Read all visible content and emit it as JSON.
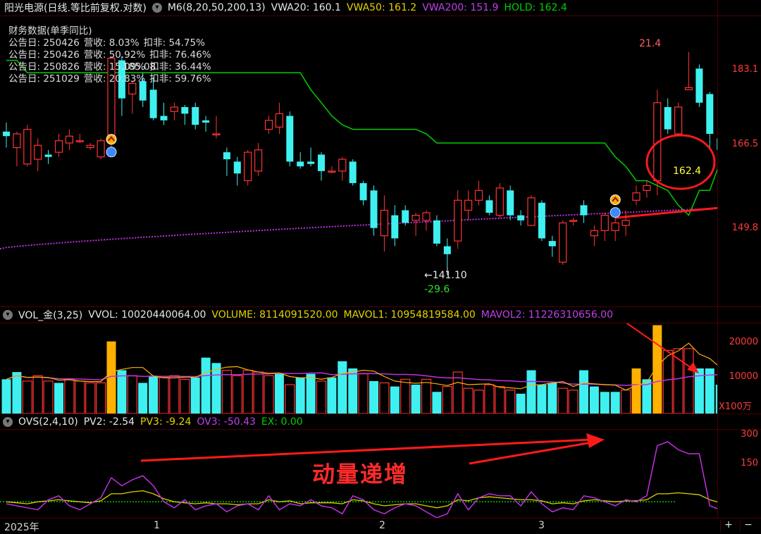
{
  "main_header": {
    "title": "阳光电源(日线.等比前复权.对数)",
    "indicator": "M6(8,20,50,200,13)",
    "vwa20": "VWA20: 160.1",
    "vwa50": "VWA50: 161.2",
    "vwa200": "VWA200: 151.9",
    "hold": "HOLD: 162.4"
  },
  "financial": {
    "title": "财务数据(单季同比)",
    "rows": [
      {
        "date": "公告日: 250426",
        "rev": "营收:  8.03%",
        "net": "扣非:  54.75%"
      },
      {
        "date": "公告日: 250426",
        "rev": "营收:  50.92%",
        "net": "扣非:  76.46%"
      },
      {
        "date": "公告日: 250826",
        "rev": "营收:  15.09%",
        "net": "扣非:  36.44%"
      },
      {
        "date": "公告日: 251029",
        "rev": "营收:  20.83%",
        "net": "扣非:  59.76%"
      }
    ],
    "overlap_text": "185.08"
  },
  "price_annotations": {
    "high_change": "21.4",
    "low_price": "←141.10",
    "low_change": "-29.6",
    "hold_value": "162.4"
  },
  "vol_header": {
    "name": "VOL_金(3,25)",
    "vvol": "VVOL: 10020440064.00",
    "volume": "VOLUME: 8114091520.00",
    "mavol1": "MAVOL1: 10954819584.00",
    "mavol2": "MAVOL2: 11226310656.00"
  },
  "vol_unit": "X100万",
  "ovs_header": {
    "name": "OVS(2,4,10)",
    "pv2": "PV2: -2.54",
    "pv3": "PV3: -9.24",
    "ov3": "OV3: -50.43",
    "ex": "EX: 0.00"
  },
  "big_note": "动量递增",
  "xaxis": {
    "year": "2025年",
    "m1": "1",
    "m2": "2",
    "m3": "3"
  },
  "zoom": {
    "plus": "+",
    "minus": "−"
  },
  "colors": {
    "up": "#ff3333",
    "down": "#3ff0f0",
    "vwa20": "#00cc00",
    "vwa200": "#c030e0",
    "hold": "#ff1a1a",
    "gold": "#ffb000",
    "ovs_pv2": "#c030e0",
    "ovs_pv3": "#e0d000",
    "ovs_ex": "#00cc00"
  },
  "chart_data": [
    {
      "type": "candlestick",
      "name": "price",
      "ylim": [
        134,
        196
      ],
      "scale": "log",
      "y_ticks": [
        183.1,
        166.5,
        149.8
      ],
      "candles": [
        {
          "o": 168.5,
          "h": 170.5,
          "l": 165,
          "c": 167.5
        },
        {
          "o": 165,
          "h": 168.5,
          "l": 161,
          "c": 168
        },
        {
          "o": 161.5,
          "h": 170,
          "l": 161,
          "c": 169
        },
        {
          "o": 162.5,
          "h": 167,
          "l": 160,
          "c": 165.5
        },
        {
          "o": 163.5,
          "h": 164.5,
          "l": 161.5,
          "c": 163
        },
        {
          "o": 164,
          "h": 168,
          "l": 163,
          "c": 166.5
        },
        {
          "o": 166,
          "h": 169,
          "l": 164.5,
          "c": 167.5
        },
        {
          "o": 166.5,
          "h": 168,
          "l": 166,
          "c": 166.5
        },
        {
          "o": 165,
          "h": 166,
          "l": 164.5,
          "c": 165.5
        },
        {
          "o": 163,
          "h": 167,
          "l": 162.5,
          "c": 166.5
        },
        {
          "o": 167,
          "h": 186,
          "l": 165,
          "c": 185.5
        },
        {
          "o": 185,
          "h": 186,
          "l": 172,
          "c": 176
        },
        {
          "o": 177,
          "h": 180,
          "l": 172.5,
          "c": 179.5
        },
        {
          "o": 180,
          "h": 182,
          "l": 174,
          "c": 175.5
        },
        {
          "o": 178,
          "h": 181,
          "l": 171,
          "c": 171.5
        },
        {
          "o": 172,
          "h": 175,
          "l": 170,
          "c": 171
        },
        {
          "o": 173,
          "h": 175,
          "l": 171,
          "c": 174
        },
        {
          "o": 174,
          "h": 174.5,
          "l": 170,
          "c": 172.5
        },
        {
          "o": 174,
          "h": 175,
          "l": 169,
          "c": 170
        },
        {
          "o": 171,
          "h": 172,
          "l": 168.5,
          "c": 170.5
        },
        {
          "o": 168,
          "h": 172,
          "l": 167,
          "c": 168
        },
        {
          "o": 164,
          "h": 165,
          "l": 159,
          "c": 162.5
        },
        {
          "o": 162,
          "h": 163,
          "l": 157,
          "c": 159.5
        },
        {
          "o": 158,
          "h": 164.5,
          "l": 157,
          "c": 164
        },
        {
          "o": 160,
          "h": 166,
          "l": 159,
          "c": 164.5
        },
        {
          "o": 169,
          "h": 172,
          "l": 168,
          "c": 171
        },
        {
          "o": 169.5,
          "h": 175,
          "l": 168,
          "c": 172.5
        },
        {
          "o": 172,
          "h": 173,
          "l": 161,
          "c": 162
        },
        {
          "o": 162,
          "h": 164,
          "l": 160.5,
          "c": 161
        },
        {
          "o": 162,
          "h": 165,
          "l": 161,
          "c": 161.5
        },
        {
          "o": 163.5,
          "h": 164,
          "l": 158,
          "c": 160
        },
        {
          "o": 160,
          "h": 161,
          "l": 159.5,
          "c": 160
        },
        {
          "o": 160,
          "h": 163,
          "l": 158,
          "c": 162.5
        },
        {
          "o": 162,
          "h": 162.5,
          "l": 157,
          "c": 157.5
        },
        {
          "o": 157.5,
          "h": 158,
          "l": 153,
          "c": 154
        },
        {
          "o": 156,
          "h": 157,
          "l": 147,
          "c": 148.5
        },
        {
          "o": 147,
          "h": 155,
          "l": 144,
          "c": 152
        },
        {
          "o": 151,
          "h": 153,
          "l": 145,
          "c": 146.5
        },
        {
          "o": 152,
          "h": 153,
          "l": 149,
          "c": 149.5
        },
        {
          "o": 150,
          "h": 151.5,
          "l": 147,
          "c": 151
        },
        {
          "o": 150,
          "h": 152,
          "l": 148,
          "c": 151.5
        },
        {
          "o": 150,
          "h": 151,
          "l": 145,
          "c": 145.5
        },
        {
          "o": 145,
          "h": 146.5,
          "l": 141.1,
          "c": 143.5
        },
        {
          "o": 146,
          "h": 156,
          "l": 144.5,
          "c": 154
        },
        {
          "o": 152,
          "h": 156,
          "l": 150,
          "c": 154
        },
        {
          "o": 154,
          "h": 158,
          "l": 153,
          "c": 156
        },
        {
          "o": 154,
          "h": 155,
          "l": 151,
          "c": 151.5
        },
        {
          "o": 151,
          "h": 157.5,
          "l": 150.5,
          "c": 156.5
        },
        {
          "o": 156,
          "h": 157,
          "l": 150,
          "c": 151
        },
        {
          "o": 151,
          "h": 152,
          "l": 149,
          "c": 150
        },
        {
          "o": 149,
          "h": 155,
          "l": 149,
          "c": 154.5
        },
        {
          "o": 153.5,
          "h": 154,
          "l": 146,
          "c": 146.5
        },
        {
          "o": 146,
          "h": 147,
          "l": 143,
          "c": 145
        },
        {
          "o": 142,
          "h": 150,
          "l": 141.5,
          "c": 149.5
        },
        {
          "o": 150,
          "h": 150.5,
          "l": 149,
          "c": 150
        },
        {
          "o": 153,
          "h": 154,
          "l": 149.5,
          "c": 151
        },
        {
          "o": 147,
          "h": 149,
          "l": 145,
          "c": 148
        },
        {
          "o": 148,
          "h": 151.5,
          "l": 146,
          "c": 151
        },
        {
          "o": 148,
          "h": 151,
          "l": 146,
          "c": 149.5
        },
        {
          "o": 149,
          "h": 152,
          "l": 147,
          "c": 150
        },
        {
          "o": 154,
          "h": 157,
          "l": 153,
          "c": 155.5
        },
        {
          "o": 156,
          "h": 158,
          "l": 154.5,
          "c": 157
        },
        {
          "o": 158,
          "h": 178,
          "l": 155,
          "c": 175
        },
        {
          "o": 174,
          "h": 176,
          "l": 168,
          "c": 169
        },
        {
          "o": 168,
          "h": 175,
          "l": 168,
          "c": 174
        },
        {
          "o": 178,
          "h": 187,
          "l": 178,
          "c": 178.5
        },
        {
          "o": 183,
          "h": 184,
          "l": 174,
          "c": 175
        },
        {
          "o": 177,
          "h": 177.5,
          "l": 165,
          "c": 168
        },
        {
          "o": 167,
          "h": 168,
          "l": 164,
          "c": 164.5
        }
      ],
      "vwa20_line": [
        185,
        185,
        182,
        182,
        182,
        182,
        182,
        182,
        182,
        182,
        182,
        182,
        182,
        182,
        182,
        182,
        182,
        182,
        182,
        182,
        182,
        182,
        182,
        182,
        182,
        182,
        182,
        182,
        182,
        178,
        175,
        172,
        170,
        169,
        169,
        169,
        169,
        169,
        169,
        169,
        168,
        166,
        166,
        166,
        166,
        166,
        166,
        166,
        166,
        166,
        166,
        166,
        166,
        166,
        166,
        166,
        166,
        166,
        163,
        161,
        158,
        158,
        157,
        156,
        153,
        151,
        156,
        156,
        162,
        163
      ],
      "vwa200_line_range": [
        144.5,
        152.5
      ],
      "hold_line_range": [
        150.5,
        152.5
      ]
    },
    {
      "type": "bar",
      "name": "volume",
      "ylim": [
        0,
        25000
      ],
      "y_ticks": [
        20000,
        10000
      ],
      "bars": [
        {
          "v": 9500,
          "up": false
        },
        {
          "v": 11500,
          "up": false
        },
        {
          "v": 9000,
          "up": true
        },
        {
          "v": 10500,
          "up": true
        },
        {
          "v": 9000,
          "up": true
        },
        {
          "v": 8500,
          "up": false
        },
        {
          "v": 9500,
          "up": true
        },
        {
          "v": 9000,
          "up": true
        },
        {
          "v": 8500,
          "up": true
        },
        {
          "v": 8500,
          "up": true
        },
        {
          "v": 20000,
          "gold": true
        },
        {
          "v": 12000,
          "up": false
        },
        {
          "v": 10500,
          "up": true
        },
        {
          "v": 8500,
          "up": false
        },
        {
          "v": 10500,
          "up": false
        },
        {
          "v": 10000,
          "up": true
        },
        {
          "v": 10500,
          "up": true
        },
        {
          "v": 9500,
          "up": true
        },
        {
          "v": 10000,
          "up": false
        },
        {
          "v": 15500,
          "up": false
        },
        {
          "v": 14000,
          "up": false
        },
        {
          "v": 12000,
          "up": true
        },
        {
          "v": 10500,
          "up": true
        },
        {
          "v": 12000,
          "up": true
        },
        {
          "v": 11500,
          "up": true
        },
        {
          "v": 10500,
          "up": true
        },
        {
          "v": 11000,
          "up": false
        },
        {
          "v": 8000,
          "up": true
        },
        {
          "v": 10000,
          "up": false
        },
        {
          "v": 11000,
          "up": false
        },
        {
          "v": 9000,
          "up": true
        },
        {
          "v": 10000,
          "up": false
        },
        {
          "v": 14500,
          "up": false
        },
        {
          "v": 12500,
          "up": false
        },
        {
          "v": 11000,
          "up": true
        },
        {
          "v": 9000,
          "up": false
        },
        {
          "v": 8500,
          "up": true
        },
        {
          "v": 7500,
          "up": false
        },
        {
          "v": 9500,
          "up": true
        },
        {
          "v": 8000,
          "up": false
        },
        {
          "v": 9500,
          "up": true
        },
        {
          "v": 6000,
          "up": false
        },
        {
          "v": 7500,
          "up": true
        },
        {
          "v": 11500,
          "up": true
        },
        {
          "v": 7000,
          "up": true
        },
        {
          "v": 6500,
          "up": true
        },
        {
          "v": 8000,
          "up": true
        },
        {
          "v": 7500,
          "up": true
        },
        {
          "v": 6500,
          "up": true
        },
        {
          "v": 5500,
          "up": false
        },
        {
          "v": 12000,
          "up": false
        },
        {
          "v": 8000,
          "up": false
        },
        {
          "v": 8500,
          "up": false
        },
        {
          "v": 7000,
          "up": true
        },
        {
          "v": 6500,
          "up": true
        },
        {
          "v": 12000,
          "up": false
        },
        {
          "v": 7500,
          "up": false
        },
        {
          "v": 6000,
          "up": false
        },
        {
          "v": 6000,
          "up": false
        },
        {
          "v": 6500,
          "up": true
        },
        {
          "v": 12500,
          "gold": true
        },
        {
          "v": 9500,
          "up": false
        },
        {
          "v": 24500,
          "gold": true
        },
        {
          "v": 17500,
          "up": true
        },
        {
          "v": 18000,
          "up": true
        },
        {
          "v": 18000,
          "up": true
        },
        {
          "v": 12500,
          "up": false
        },
        {
          "v": 12500,
          "up": false
        },
        {
          "v": 8000,
          "up": false
        }
      ]
    },
    {
      "type": "line",
      "name": "OVS",
      "ylim": [
        -80,
        360
      ],
      "y_ticks": [
        300.0,
        150.0
      ],
      "series_pv2": [
        -10,
        -20,
        -30,
        -40,
        10,
        30,
        -20,
        -40,
        -10,
        20,
        120,
        80,
        110,
        130,
        80,
        0,
        -30,
        10,
        -40,
        -20,
        -10,
        -50,
        -20,
        -10,
        -40,
        30,
        -40,
        -10,
        -20,
        10,
        -20,
        -30,
        -60,
        30,
        10,
        -40,
        -60,
        -30,
        -10,
        -20,
        -50,
        -80,
        -60,
        40,
        -40,
        20,
        40,
        30,
        30,
        -20,
        50,
        -10,
        -50,
        -30,
        -40,
        30,
        20,
        0,
        -20,
        10,
        0,
        30,
        280,
        300,
        260,
        240,
        240,
        -20,
        -40
      ],
      "series_pv3": [
        0,
        -5,
        -10,
        0,
        5,
        10,
        5,
        0,
        -5,
        5,
        40,
        40,
        50,
        55,
        40,
        15,
        0,
        -5,
        -10,
        -5,
        -10,
        -10,
        -15,
        -10,
        -10,
        10,
        0,
        5,
        -10,
        -5,
        -5,
        -5,
        -10,
        10,
        5,
        -10,
        -20,
        -15,
        -10,
        -10,
        -20,
        -30,
        -20,
        10,
        5,
        20,
        25,
        20,
        15,
        10,
        10,
        5,
        -10,
        -5,
        -10,
        5,
        10,
        5,
        0,
        5,
        5,
        10,
        40,
        40,
        45,
        40,
        35,
        10,
        -5
      ],
      "ex_level": 0
    }
  ]
}
